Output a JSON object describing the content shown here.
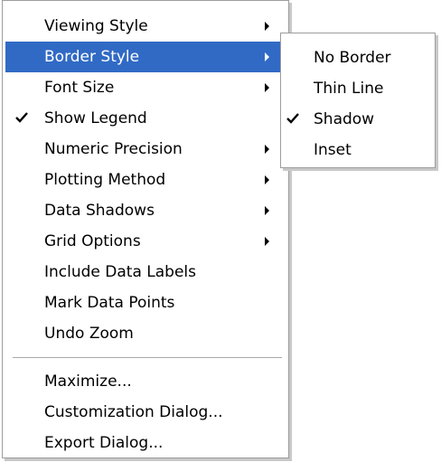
{
  "main_menu": {
    "items": [
      {
        "label": "Viewing Style",
        "submenu": true
      },
      {
        "label": "Border Style",
        "submenu": true,
        "highlighted": true
      },
      {
        "label": "Font Size",
        "submenu": true
      },
      {
        "label": "Show Legend",
        "checked": true
      },
      {
        "label": "Numeric Precision",
        "submenu": true
      },
      {
        "label": "Plotting Method",
        "submenu": true
      },
      {
        "label": "Data Shadows",
        "submenu": true
      },
      {
        "label": "Grid Options",
        "submenu": true
      },
      {
        "label": "Include Data Labels"
      },
      {
        "label": "Mark Data Points"
      },
      {
        "label": "Undo Zoom"
      },
      {
        "label": "Maximize..."
      },
      {
        "label": "Customization Dialog..."
      },
      {
        "label": "Export Dialog..."
      }
    ]
  },
  "border_style_submenu": {
    "items": [
      {
        "label": "No Border"
      },
      {
        "label": "Thin Line"
      },
      {
        "label": "Shadow",
        "checked": true
      },
      {
        "label": "Inset"
      }
    ]
  },
  "colors": {
    "highlight": "#316ac5",
    "highlight_text": "#ffffff",
    "menu_border": "#9d9d9d"
  }
}
